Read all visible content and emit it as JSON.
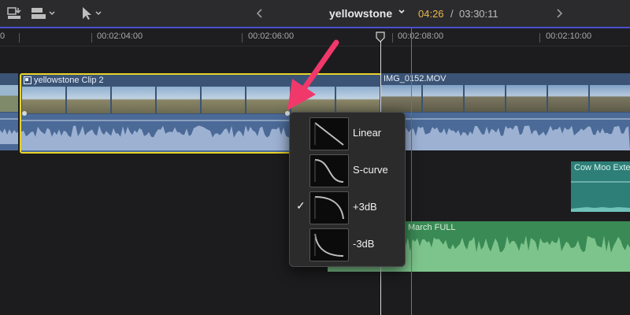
{
  "toolbar": {
    "import_icon": "import-media-icon",
    "clip_appearance_icon": "clip-appearance-icon",
    "select_tool_icon": "select-arrow-tool-icon",
    "prev_icon": "chevron-left-icon",
    "next_icon": "chevron-right-icon",
    "project_name": "yellowstone",
    "timecode_current": "04:26",
    "timecode_separator": "/",
    "timecode_total": "03:30:11"
  },
  "ruler": {
    "labels": [
      "0",
      "00:00:02:04:00",
      "00:00:02:06:00",
      "00:00:02:08:00",
      "00:00:02:10:00"
    ],
    "shown": [
      "0",
      "00:00:02:04:00",
      "00:00:02:06:00",
      "00:00:02:08:00",
      "00:00:02:10:00"
    ]
  },
  "ruler_text": {
    "t0": "0",
    "t1": "00:02:04:00",
    "t2": "00:02:06:00",
    "t3": "00:02:08:00",
    "t4": "00:02:10:00"
  },
  "timeline": {
    "clips": [
      {
        "name": "yellowstone Clip 2",
        "selected": true
      },
      {
        "name": "IMG_0152.MOV",
        "selected": false
      }
    ],
    "connected_clips": [
      {
        "name": "Cow Moo Exte"
      },
      {
        "name": "March FULL"
      }
    ]
  },
  "fade_menu": {
    "items": [
      {
        "label": "Linear",
        "checked": false
      },
      {
        "label": "S-curve",
        "checked": false
      },
      {
        "label": "+3dB",
        "checked": true
      },
      {
        "label": "-3dB",
        "checked": false
      }
    ],
    "checkmark": "✓"
  },
  "colors": {
    "selection": "#e8d32a",
    "playhead": "#d8d8d8",
    "skimmer": "#d94a3c",
    "timecode_highlight": "#e8b84a",
    "annotation_arrow": "#f0386b"
  }
}
